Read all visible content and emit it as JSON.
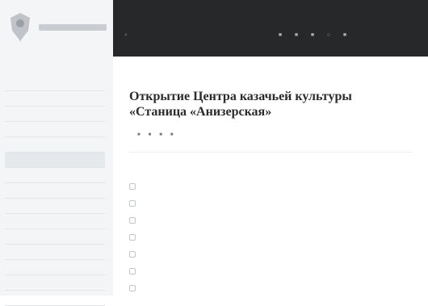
{
  "header": {
    "site_name": "",
    "nav": [
      "",
      "",
      "",
      "",
      "",
      ""
    ],
    "search_label": "",
    "right_text": ""
  },
  "sidebar": {
    "heading": "",
    "items": [
      "",
      "",
      "",
      "",
      "",
      "",
      "",
      "",
      "",
      "",
      "",
      "",
      "",
      "",
      ""
    ]
  },
  "page": {
    "breadcrumbs": [
      "",
      ""
    ],
    "date": "",
    "title": "Открытие Центра казачьей культуры «Станица «Анизерская»",
    "share_label": "",
    "share_icons": [
      "vk-icon",
      "facebook-icon",
      "twitter-icon",
      "ok-icon"
    ],
    "info": [
      {
        "key": "",
        "value": ""
      },
      {
        "key": "",
        "value": ""
      },
      {
        "key": "",
        "value": ""
      },
      {
        "key": "",
        "value": ""
      },
      {
        "key": "",
        "value": ""
      },
      {
        "key": "",
        "value": ""
      },
      {
        "key": "",
        "value": ""
      }
    ]
  },
  "colors": {
    "topbar": "#262829",
    "sidebar": "#f4f5f6",
    "accent": "#2b2b2b"
  }
}
